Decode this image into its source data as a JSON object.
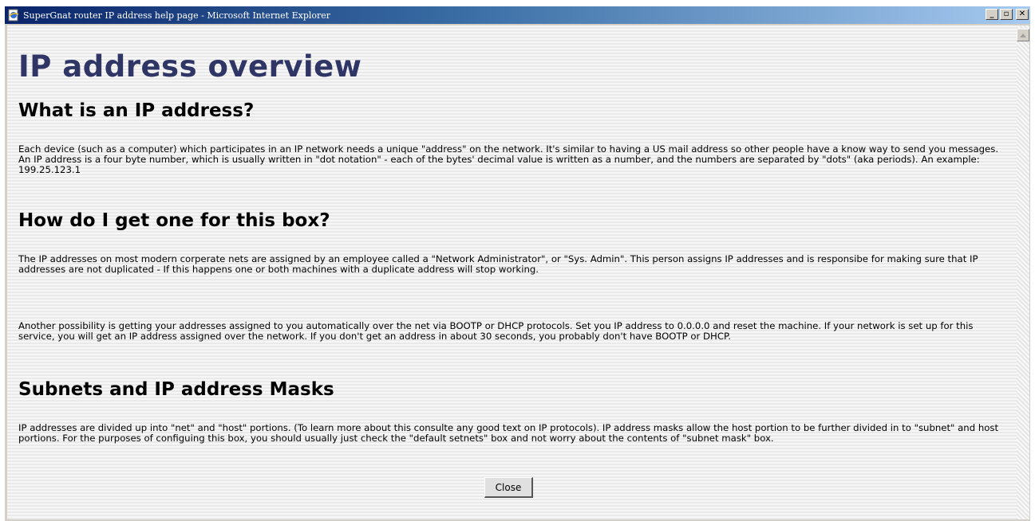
{
  "window": {
    "title": "SuperGnat router IP address help page - Microsoft Internet Explorer",
    "minimize_label": "_",
    "maximize_label": "▫",
    "close_label": "✕"
  },
  "page": {
    "title": "IP address overview",
    "sections": [
      {
        "heading": "What is an IP address?",
        "paragraphs": [
          "Each device (such as a computer) which participates in an IP network needs a unique \"address\" on the network. It's similar to having a US mail address so other people have a know way to send you messages. An IP address is a four byte number, which is usually written in \"dot notation\" - each of the bytes' decimal value is written as a number, and the numbers are separated by \"dots\" (aka periods). An example: 199.25.123.1"
        ]
      },
      {
        "heading": "How do I get one for this box?",
        "paragraphs": [
          "The IP addresses on most modern corperate nets are assigned by an employee called a \"Network Administrator\", or \"Sys. Admin\". This person assigns IP addresses and is responsibe for making sure that IP addresses are not duplicated - If this happens one or both machines with a duplicate address will stop working.",
          "Another possibility is getting your addresses assigned to you automatically over the net via BOOTP or DHCP protocols. Set you IP address to 0.0.0.0 and reset the machine. If your network is set up for this service, you will get an IP address assigned over the network. If you don't get an address in about 30 seconds, you probably don't have BOOTP or DHCP."
        ]
      },
      {
        "heading": "Subnets and IP address Masks",
        "paragraphs": [
          "IP addresses are divided up into \"net\" and \"host\" portions. (To learn more about this consulte any good text on IP protocols). IP address masks allow the host portion to be further divided in to \"subnet\" and host portions. For the purposes of configuing this box, you should usually just check the \"default setnets\" box and not worry about the contents of \"subnet mask\" box."
        ]
      }
    ],
    "close_button_label": "Close"
  },
  "icons": {
    "app": "ie-page-icon",
    "scroll_up": "triangle-up-icon"
  },
  "colors": {
    "title_text": "#2f3565",
    "titlebar_start": "#0a246a",
    "titlebar_end": "#a6caf0"
  }
}
